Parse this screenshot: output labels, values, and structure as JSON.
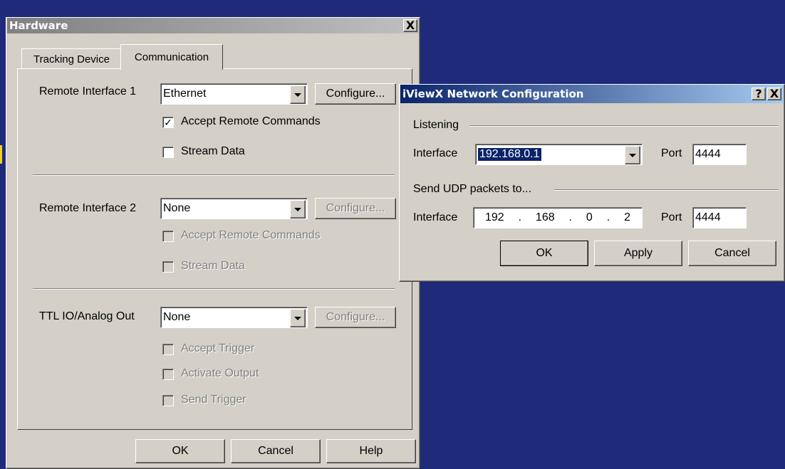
{
  "hardware_dialog": {
    "title": "Hardware",
    "close_glyph": "X",
    "tabs": [
      {
        "label": "Tracking Device",
        "active": false
      },
      {
        "label": "Communication",
        "active": true
      }
    ],
    "remote1": {
      "label": "Remote Interface 1",
      "value": "Ethernet",
      "configure": "Configure...",
      "accept_label": "Accept Remote Commands",
      "accept_checked": true,
      "stream_label": "Stream Data",
      "stream_checked": false
    },
    "remote2": {
      "label": "Remote Interface 2",
      "value": "None",
      "configure": "Configure...",
      "accept_label": "Accept Remote Commands",
      "stream_label": "Stream Data"
    },
    "ttl": {
      "label": "TTL IO/Analog Out",
      "value": "None",
      "configure": "Configure...",
      "trigger_label": "Accept Trigger",
      "activate_label": "Activate Output",
      "send_label": "Send Trigger"
    },
    "buttons": {
      "ok": "OK",
      "cancel": "Cancel",
      "help": "Help"
    }
  },
  "network_dialog": {
    "title": "iViewX Network Configuration",
    "help_glyph": "?",
    "close_glyph": "X",
    "listening": {
      "group_label": "Listening",
      "interface_label": "Interface",
      "interface_value": "192.168.0.1",
      "port_label": "Port",
      "port_value": "4444"
    },
    "send": {
      "group_label": "Send UDP packets to...",
      "interface_label": "Interface",
      "ip_octets": [
        "192",
        "168",
        "0",
        "2"
      ],
      "port_label": "Port",
      "port_value": "4444"
    },
    "buttons": {
      "ok": "OK",
      "apply": "Apply",
      "cancel": "Cancel"
    }
  },
  "colors": {
    "desktop": "#1f2a7a",
    "face": "#d4d0c8",
    "active_title": "#0a246a",
    "inactive_title": "#808080"
  }
}
